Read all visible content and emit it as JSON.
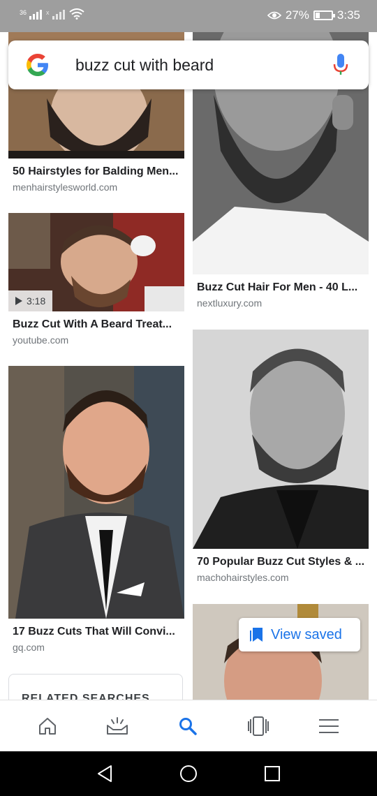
{
  "status_bar": {
    "signal1_label": "36",
    "signal2_label": "x",
    "battery_percent": "27%",
    "battery_level": 0.27,
    "time": "3:35"
  },
  "search": {
    "query": "buzz cut with beard"
  },
  "results": [
    {
      "title": "50 Hairstyles for Balding Men...",
      "source": "menhairstylesworld.com"
    },
    {
      "title": "Buzz Cut With A Beard Treat...",
      "source": "youtube.com",
      "duration": "3:18"
    },
    {
      "title": "17 Buzz Cuts That Will Convi...",
      "source": "gq.com"
    },
    {
      "title": "Buzz Cut Hair For Men - 40 L...",
      "source": "nextluxury.com"
    },
    {
      "title": "70 Popular Buzz Cut Styles & ...",
      "source": "machohairstyles.com"
    }
  ],
  "related": {
    "label": "RELATED SEARCHES"
  },
  "view_saved": {
    "label": "View saved"
  },
  "bottom_nav": {
    "items": [
      {
        "name": "home",
        "icon": "home-icon"
      },
      {
        "name": "updates",
        "icon": "updates-icon"
      },
      {
        "name": "search",
        "icon": "search-icon",
        "active": true
      },
      {
        "name": "tabs",
        "icon": "tabs-icon"
      },
      {
        "name": "menu",
        "icon": "menu-icon"
      }
    ]
  },
  "colors": {
    "accent": "#1a73e8",
    "status_bar": "#9e9e9e",
    "system_nav": "#000000"
  }
}
